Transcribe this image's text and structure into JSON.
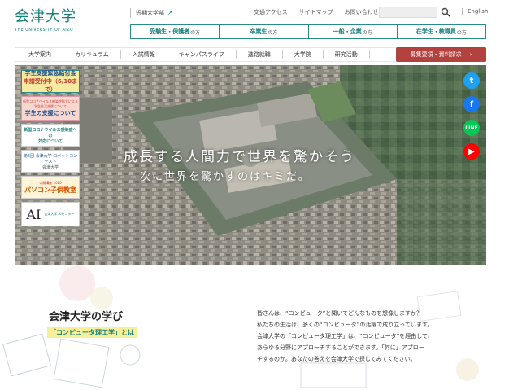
{
  "header": {
    "logo_jp": "会津大学",
    "logo_en": "THE UNIVERSITY OF AIZU",
    "short_college": "短期大学部",
    "util_nav": [
      "交通アクセス",
      "サイトマップ",
      "お問い合わせ"
    ],
    "lang": "English"
  },
  "audience_nav": [
    {
      "label": "受験生・保護者",
      "suffix": "の方"
    },
    {
      "label": "卒業生",
      "suffix": "の方"
    },
    {
      "label": "一般・企業",
      "suffix": "の方"
    },
    {
      "label": "在学生・教職員",
      "suffix": "の方"
    }
  ],
  "main_nav": [
    "大学案内",
    "カリキュラム",
    "入試情報",
    "キャンパスライフ",
    "進路就職",
    "大学院",
    "研究活動"
  ],
  "cta": {
    "label": "募集要項・資料請求",
    "arrow": "›"
  },
  "hero": {
    "title": "成長する人間力で世界を驚かそう",
    "subtitle": "次に世界を驚かすのはキミだ。"
  },
  "banners": [
    {
      "l1": "学生支援緊急給付金",
      "l2": "申請受付中（6/10まで）"
    },
    {
      "l1": "新型コロナウイルス感染症拡大による学生生活支援について",
      "l2": "学生の支援について"
    },
    {
      "l1": "新型コロナウイルス感染症への",
      "l2": "対応について"
    },
    {
      "l1": "第5回 会津大学 ロボットコンテスト",
      "l2": "会津大学"
    },
    {
      "l1": "公開講座 2020",
      "l2": "パソコン子供教室"
    },
    {
      "l1": "AI",
      "l2": "会津大学 AIセンター"
    }
  ],
  "social": [
    {
      "name": "twitter",
      "glyph": "t",
      "color": "#1da1f2"
    },
    {
      "name": "facebook",
      "glyph": "f",
      "color": "#1877f2"
    },
    {
      "name": "line",
      "glyph": "LINE",
      "color": "#06c755"
    },
    {
      "name": "youtube",
      "glyph": "▶",
      "color": "#ff0000"
    }
  ],
  "learn": {
    "title": "会津大学の学び",
    "subtitle": "「コンピュータ理工学」とは",
    "lines": [
      "皆さんは、“コンピュータ”と聞いてどんなものを想像しますか？",
      "私たちの生活は、多くの“コンピュータ”の活躍で成り立っています。",
      "会津大学の「コンピュータ理工学」は、“コンピュータ”を経由して、",
      "あらゆる分野にアプローチすることができます。「何に」アプロー",
      "チするのか。あなたの答えを会津大学で探してみてください。"
    ]
  }
}
